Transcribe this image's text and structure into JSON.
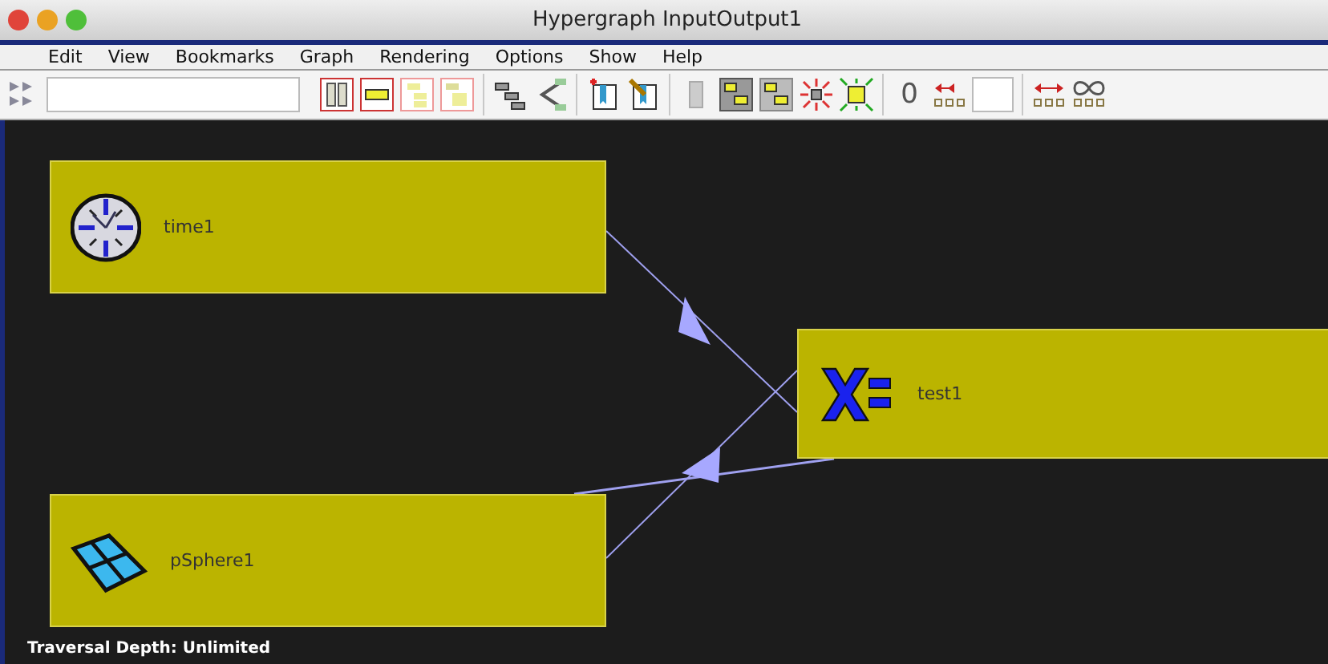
{
  "window": {
    "title": "Hypergraph InputOutput1"
  },
  "menu": [
    "Edit",
    "View",
    "Bookmarks",
    "Graph",
    "Rendering",
    "Options",
    "Show",
    "Help"
  ],
  "toolbar": {
    "zero_label": "0"
  },
  "nodes": [
    {
      "kind": "clock",
      "label": "time1"
    },
    {
      "kind": "expression",
      "label": "test1"
    },
    {
      "kind": "mesh",
      "label": "pSphere1"
    }
  ],
  "status": "Traversal Depth: Unlimited"
}
